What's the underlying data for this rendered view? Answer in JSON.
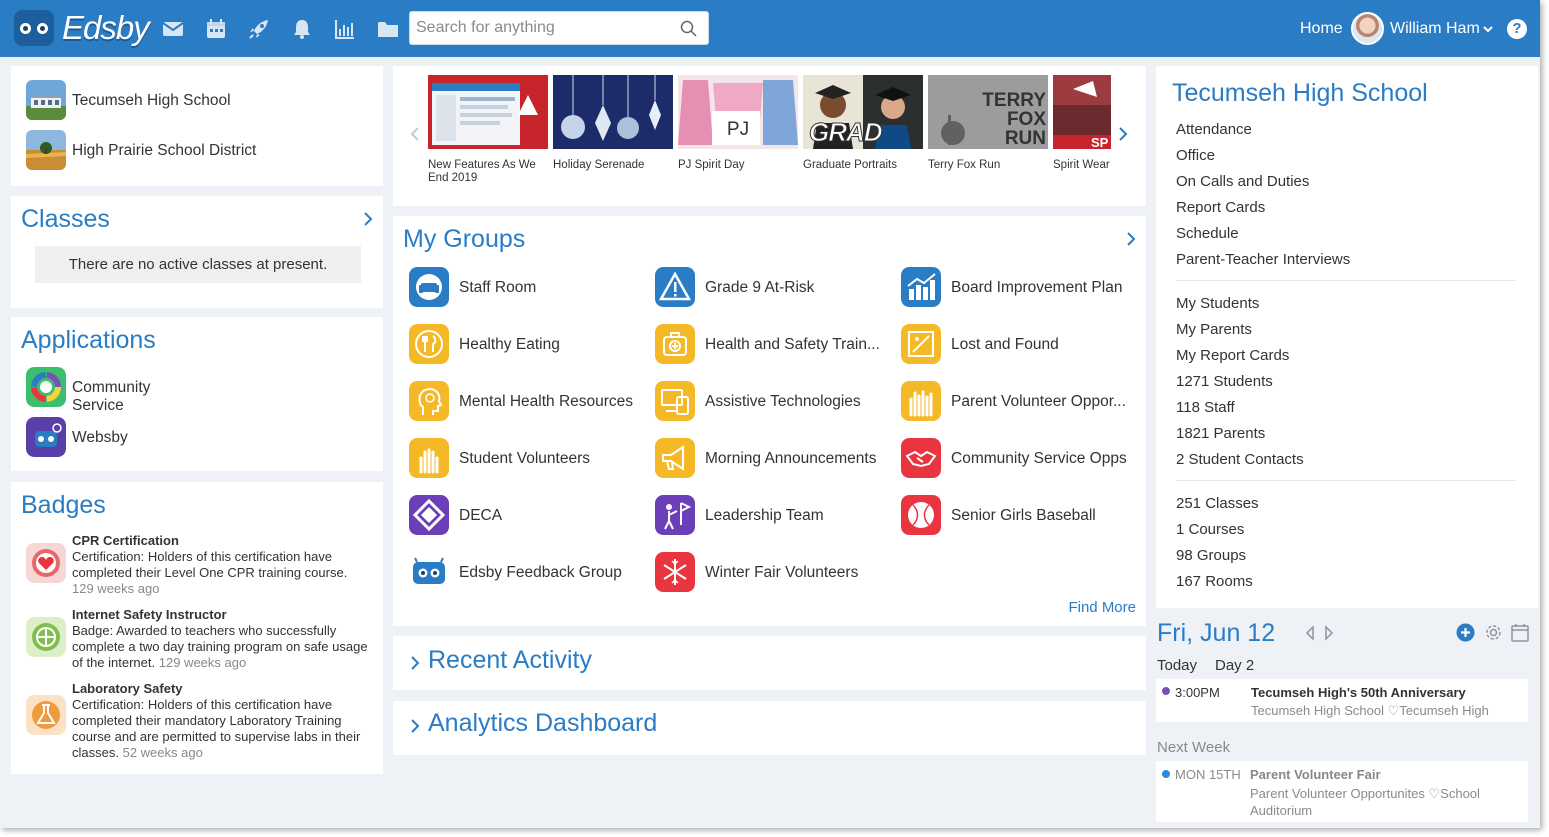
{
  "app": {
    "logo_text": "Edsby",
    "search_placeholder": "Search for anything",
    "home_label": "Home",
    "user_name": "William Ham",
    "help_label": "?"
  },
  "left": {
    "schools": [
      "Tecumseh High School",
      "High Prairie School District"
    ],
    "classes": {
      "title": "Classes",
      "empty": "There are no active classes at present."
    },
    "applications": {
      "title": "Applications",
      "items": [
        "Community Service",
        "Websby"
      ]
    },
    "badges": {
      "title": "Badges",
      "items": [
        {
          "title": "CPR Certification",
          "desc": "Certification: Holders of this certification have completed their Level One CPR training course.",
          "age": "129 weeks ago"
        },
        {
          "title": "Internet Safety Instructor",
          "desc": "Badge: Awarded to teachers who successfully complete a two day training program on safe usage of the internet.",
          "age": "129 weeks ago"
        },
        {
          "title": "Laboratory Safety",
          "desc": "Certification: Holders of this certification have completed their mandatory Laboratory Training course and are permitted to supervise labs in their classes.",
          "age": "52 weeks ago"
        }
      ]
    }
  },
  "carousel": {
    "items": [
      {
        "caption": "New Features As We End 2019",
        "overlay": ""
      },
      {
        "caption": "Holiday Serenade",
        "overlay": ""
      },
      {
        "caption": "PJ Spirit Day",
        "overlay": "PJ"
      },
      {
        "caption": "Graduate Portraits",
        "overlay": "GRAD"
      },
      {
        "caption": "Terry Fox Run",
        "overlay": "TERRY FOX RUN"
      },
      {
        "caption": "Spirit Wear",
        "overlay": "SP"
      }
    ]
  },
  "groups": {
    "title": "My Groups",
    "find_more": "Find More",
    "items": [
      {
        "label": "Staff Room",
        "icon": "couch-icon",
        "color": "#2a7cc4"
      },
      {
        "label": "Grade 9 At-Risk",
        "icon": "warning-icon",
        "color": "#2a7cc4"
      },
      {
        "label": "Board Improvement Plan",
        "icon": "bar-chart-icon",
        "color": "#2a7cc4"
      },
      {
        "label": "Healthy Eating",
        "icon": "utensils-icon",
        "color": "#f5b928"
      },
      {
        "label": "Health and Safety Train...",
        "icon": "first-aid-icon",
        "color": "#f5b928"
      },
      {
        "label": "Lost and Found",
        "icon": "picture-icon",
        "color": "#f5b928"
      },
      {
        "label": "Mental Health Resources",
        "icon": "head-icon",
        "color": "#f5b928"
      },
      {
        "label": "Assistive Technologies",
        "icon": "devices-icon",
        "color": "#f5b928"
      },
      {
        "label": "Parent Volunteer Oppor...",
        "icon": "raised-hands-icon",
        "color": "#f5b928"
      },
      {
        "label": "Student Volunteers",
        "icon": "hands-icon",
        "color": "#f5b928"
      },
      {
        "label": "Morning Announcements",
        "icon": "megaphone-icon",
        "color": "#f5b928"
      },
      {
        "label": "Community Service Opps",
        "icon": "handshake-icon",
        "color": "#e8353f"
      },
      {
        "label": "DECA",
        "icon": "deca-diamond-icon",
        "color": "#6b3fb8"
      },
      {
        "label": "Leadership Team",
        "icon": "leader-flag-icon",
        "color": "#6b3fb8"
      },
      {
        "label": "Senior Girls Baseball",
        "icon": "baseball-icon",
        "color": "#e8353f"
      },
      {
        "label": "Edsby Feedback Group",
        "icon": "edsby-robot-icon",
        "color": "#ffffff"
      },
      {
        "label": "Winter Fair Volunteers",
        "icon": "snowflake-icon",
        "color": "#e8353f"
      }
    ]
  },
  "sections": {
    "recent": "Recent Activity",
    "analytics": "Analytics Dashboard"
  },
  "right": {
    "title": "Tecumseh High School",
    "links1": [
      "Attendance",
      "Office",
      "On Calls and Duties",
      "Report Cards",
      "Schedule",
      "Parent-Teacher Interviews"
    ],
    "links2": [
      "My Students",
      "My Parents",
      "My Report Cards",
      "1271 Students",
      "118 Staff",
      "1821 Parents",
      "2 Student Contacts"
    ],
    "links3": [
      "251 Classes",
      "1 Courses",
      "98 Groups",
      "167 Rooms"
    ]
  },
  "calendar": {
    "date": "Fri, Jun 12",
    "today": "Today",
    "day": "Day 2",
    "events": [
      {
        "time": "3:00PM",
        "title": "Tecumseh High's 50th Anniversary",
        "sub": "Tecumseh High School",
        "place": "Tecumseh High",
        "dot": "#7b4fb8"
      }
    ],
    "next_week": "Next Week",
    "next_events": [
      {
        "time": "MON 15TH",
        "title": "Parent Volunteer Fair",
        "sub": "Parent Volunteer Opportunites",
        "place": "School Auditorium",
        "dot": "#2a8ae0"
      }
    ]
  }
}
